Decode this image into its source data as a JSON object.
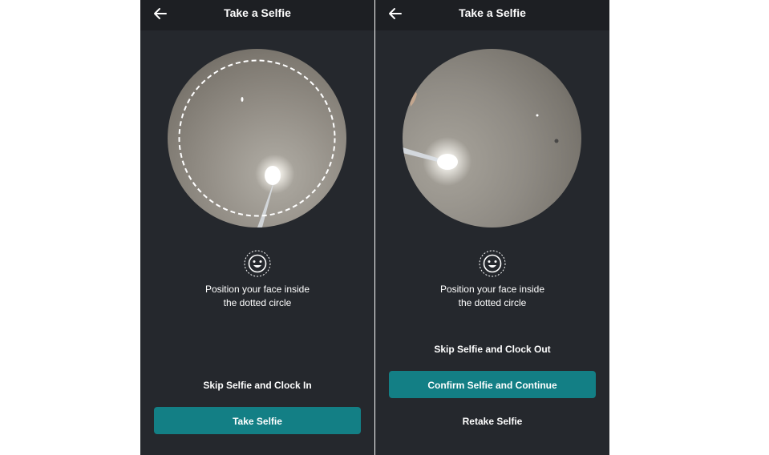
{
  "left_screen": {
    "header": {
      "title": "Take a Selfie",
      "back_icon": "arrow-left-icon"
    },
    "instruction": {
      "line1": "Position your face inside",
      "line2": "the dotted circle"
    },
    "skip_link": "Skip Selfie and Clock In",
    "primary_button": "Take Selfie"
  },
  "right_screen": {
    "header": {
      "title": "Take a Selfie",
      "back_icon": "arrow-left-icon"
    },
    "instruction": {
      "line1": "Position your face inside",
      "line2": "the dotted circle"
    },
    "skip_link": "Skip Selfie and Clock Out",
    "primary_button": "Confirm Selfie and Continue",
    "retake_link": "Retake Selfie"
  },
  "colors": {
    "background": "#25282d",
    "header": "#1d1f23",
    "accent": "#137f85",
    "text": "#ffffff"
  }
}
